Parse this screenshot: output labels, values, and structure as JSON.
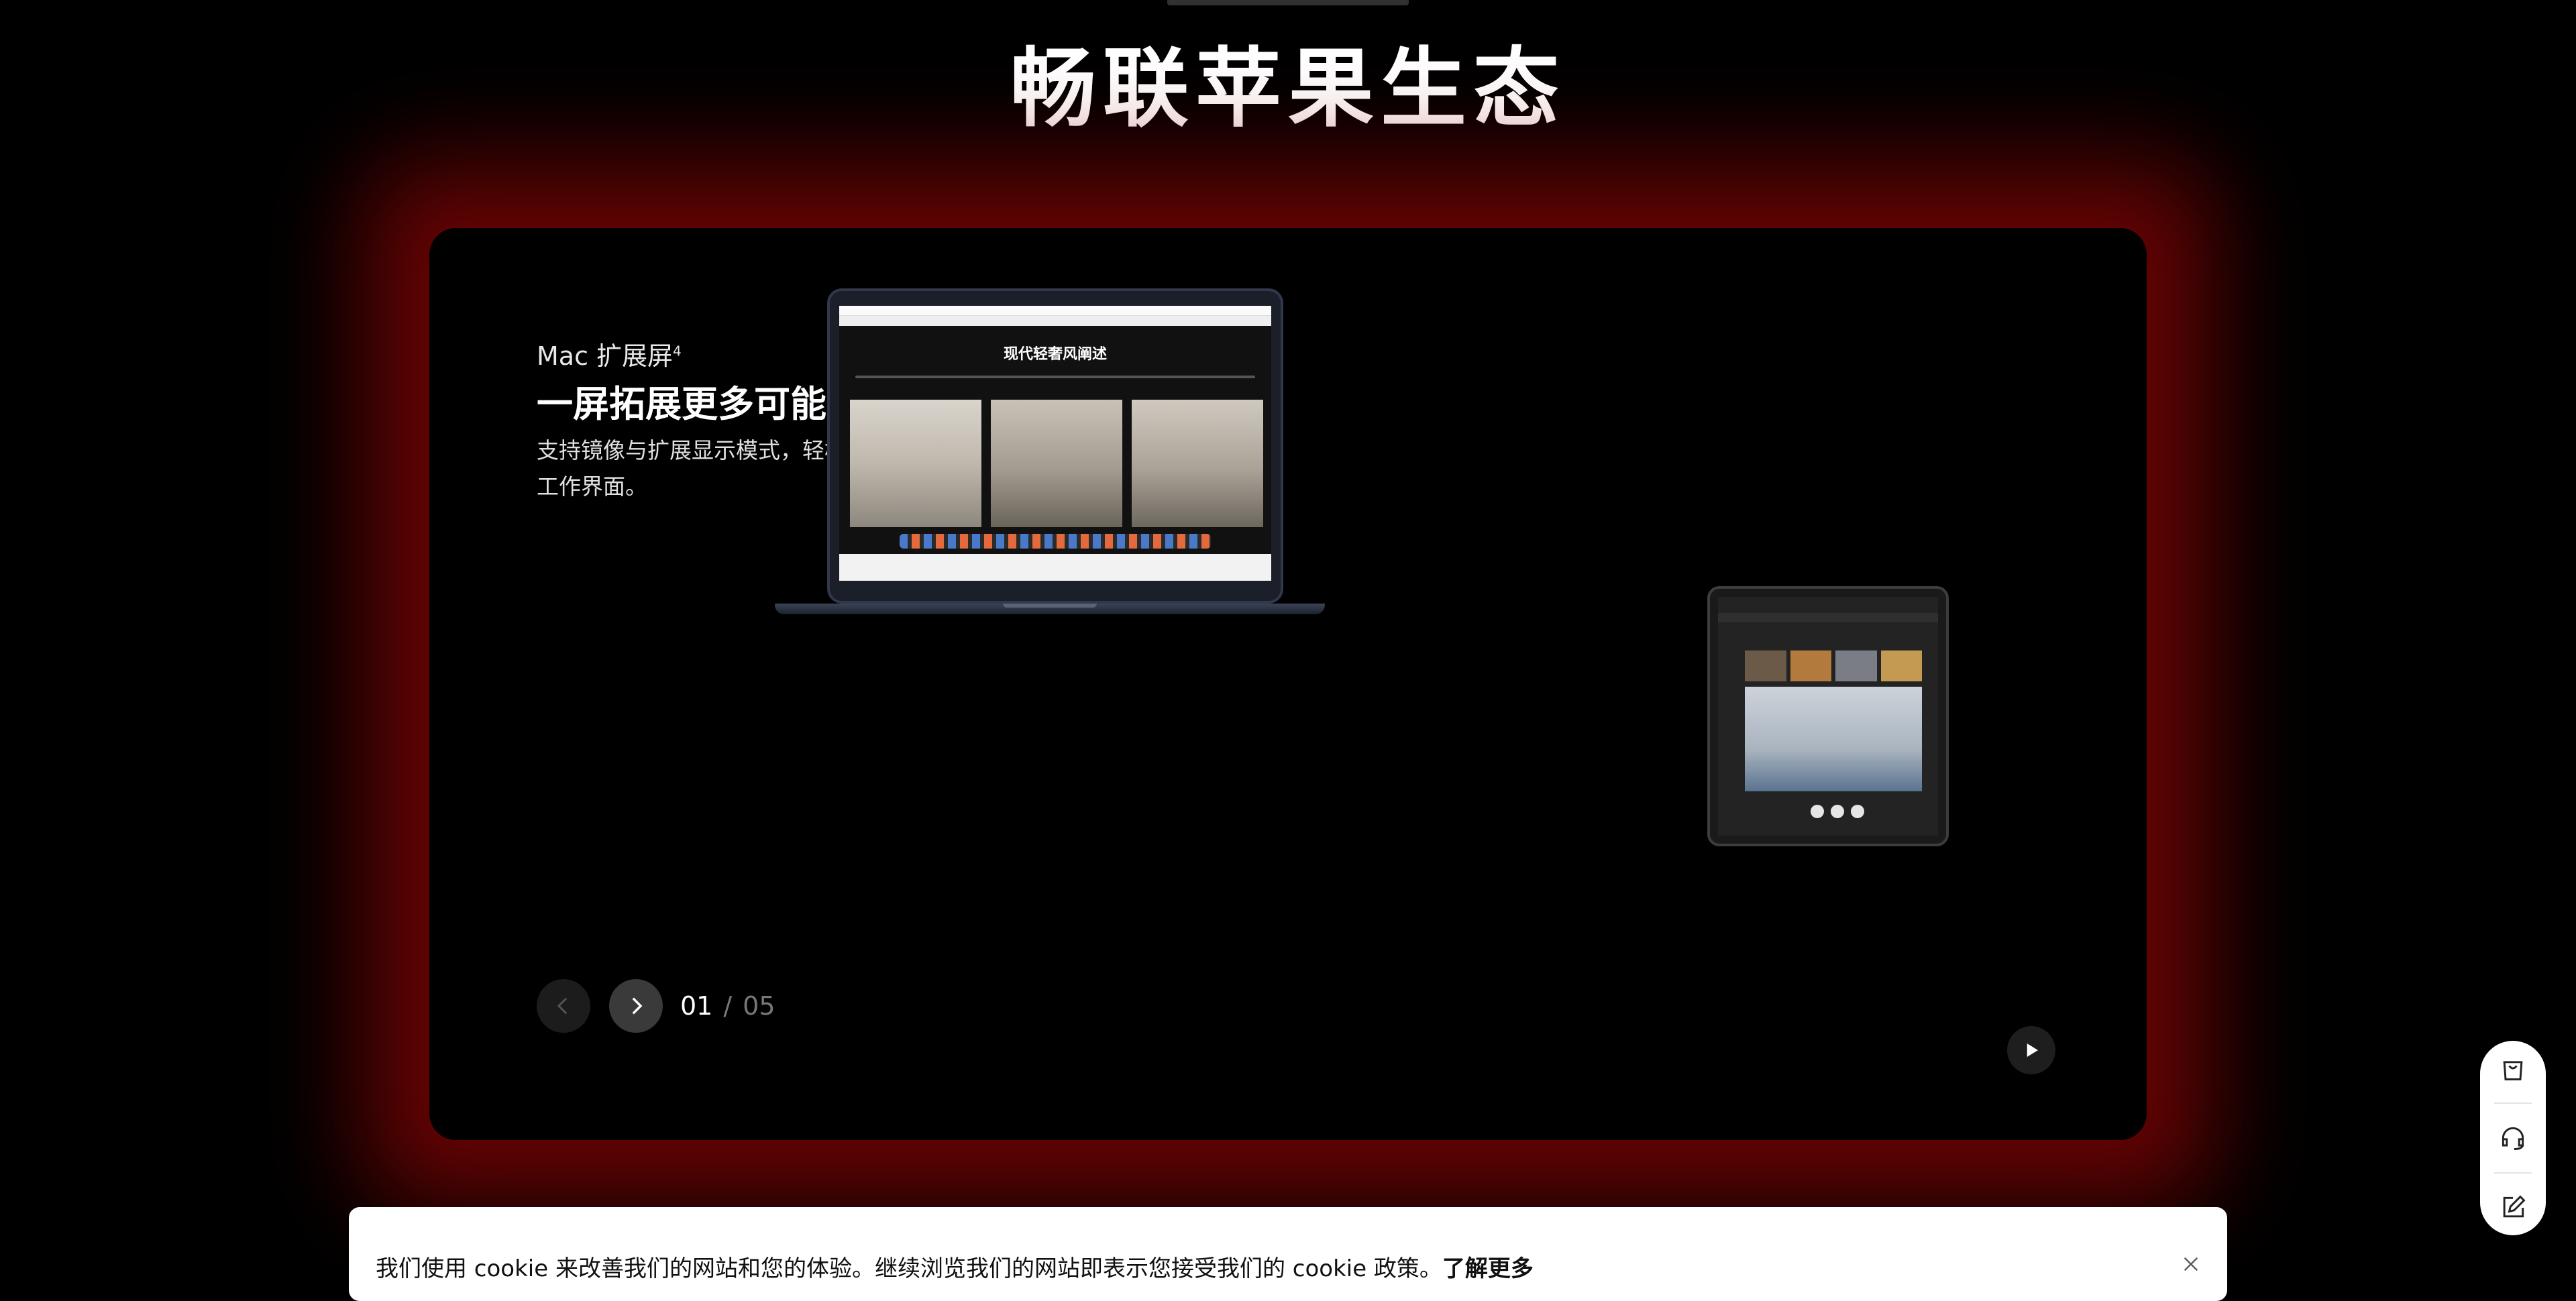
{
  "section": {
    "heading": "畅联苹果生态"
  },
  "slide": {
    "eyebrow": "Mac 扩展屏",
    "eyebrow_footnote": "4",
    "title": "一屏拓展更多可能",
    "description": "支持镜像与扩展显示模式，轻松延展 Mac 的工作界面。",
    "laptop_slide_title": "现代轻奢风阐述"
  },
  "carousel": {
    "current": "01",
    "separator": "/",
    "total": "05"
  },
  "cookie_bar": {
    "text_prefix": "我们使用 cookie 来改善我们的网站和您的体验。继续浏览我们的网站即表示您接受我们的 cookie 政策。",
    "learn_more": "了解更多"
  },
  "icons": {
    "prev": "chevron-left-icon",
    "next": "chevron-right-icon",
    "play": "play-icon",
    "cart": "shopping-bag-icon",
    "support": "headset-icon",
    "feedback": "edit-icon",
    "close": "close-icon"
  },
  "colors": {
    "background": "#000000",
    "glow": "#8c0606",
    "text": "#ffffff",
    "muted": "#777777"
  }
}
